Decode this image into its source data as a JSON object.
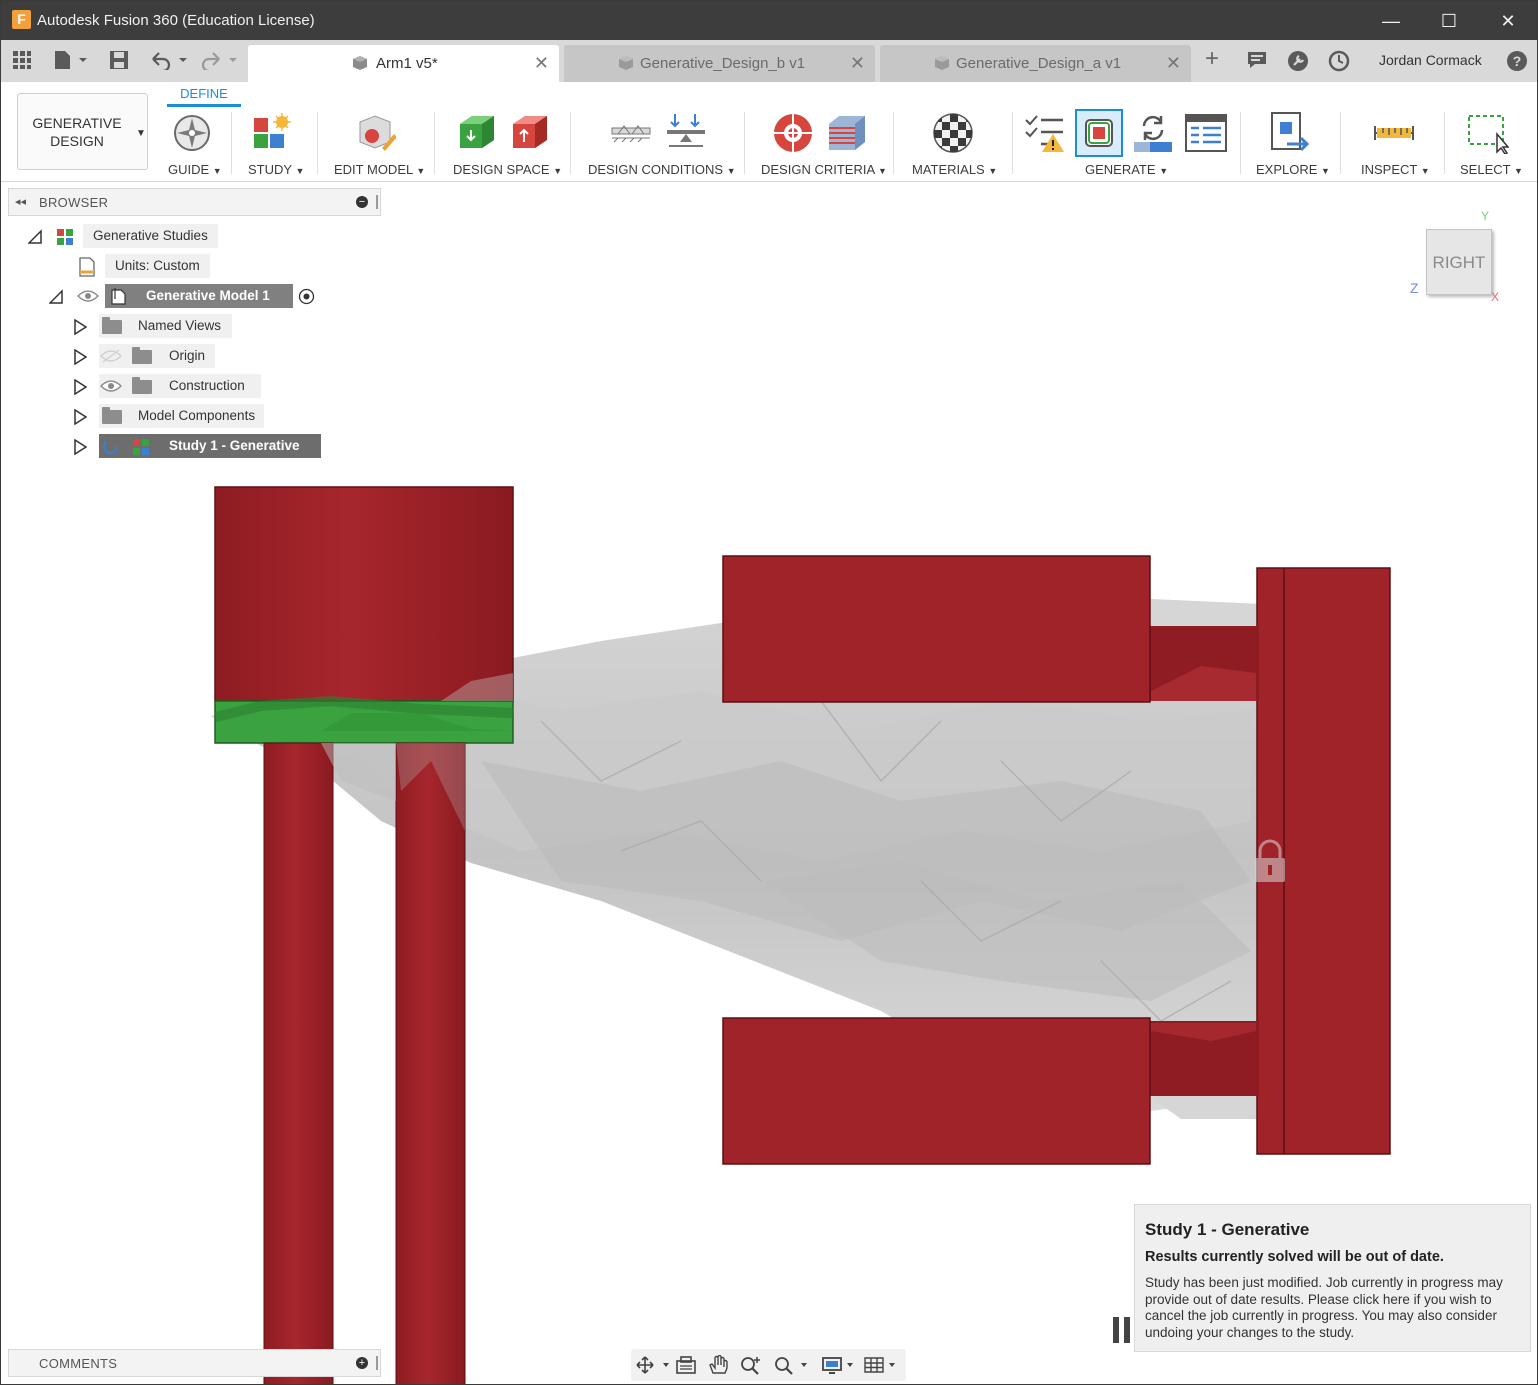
{
  "window": {
    "title": "Autodesk Fusion 360 (Education License)",
    "app_icon_letter": "F",
    "controls": {
      "minimize": "—",
      "maximize": "☐",
      "close": "✕"
    }
  },
  "quickbar": {
    "grid_icon": "grid-icon",
    "file_icon": "file-icon",
    "save_icon": "save-icon",
    "undo_icon": "undo-icon",
    "redo_icon": "redo-icon"
  },
  "tabs": [
    {
      "label": "Arm1 v5*",
      "active": true,
      "close": "✕"
    },
    {
      "label": "Generative_Design_b v1",
      "active": false,
      "close": "✕"
    },
    {
      "label": "Generative_Design_a v1",
      "active": false,
      "close": "✕"
    }
  ],
  "tabbar_right": {
    "new_tab": "+",
    "user_name": "Jordan Cormack",
    "help": "?"
  },
  "toolbar": {
    "workspace": {
      "line1": "GENERATIVE",
      "line2": "DESIGN",
      "caret": "▼"
    },
    "active_tab": "DEFINE",
    "groups": [
      {
        "label": "GUIDE",
        "caret": "▼"
      },
      {
        "label": "STUDY",
        "caret": "▼"
      },
      {
        "label": "EDIT MODEL",
        "caret": "▼"
      },
      {
        "label": "DESIGN SPACE",
        "caret": "▼"
      },
      {
        "label": "DESIGN CONDITIONS",
        "caret": "▼"
      },
      {
        "label": "DESIGN CRITERIA",
        "caret": "▼"
      },
      {
        "label": "MATERIALS",
        "caret": "▼"
      },
      {
        "label": "GENERATE",
        "caret": "▼"
      },
      {
        "label": "EXPLORE",
        "caret": "▼"
      },
      {
        "label": "INSPECT",
        "caret": "▼"
      },
      {
        "label": "SELECT",
        "caret": "▼"
      }
    ]
  },
  "browser": {
    "title": "BROWSER",
    "collapse": "◂◂",
    "minus": "−",
    "items": [
      {
        "label": "Generative Studies"
      },
      {
        "label": "Units: Custom"
      },
      {
        "label": "Generative Model 1"
      },
      {
        "label": "Named Views"
      },
      {
        "label": "Origin"
      },
      {
        "label": "Construction"
      },
      {
        "label": "Model Components"
      },
      {
        "label": "Study 1 - Generative"
      }
    ]
  },
  "viewcube": {
    "face": "RIGHT",
    "y": "Y",
    "z": "Z",
    "x": "X"
  },
  "comments": {
    "title": "COMMENTS",
    "plus": "+"
  },
  "notification": {
    "title": "Study 1 - Generative",
    "subtitle": "Results currently solved will be out of date.",
    "body": "Study has been just modified. Job currently in progress may provide out of date results. Please click here if you wish to cancel the job currently in progress. You may also consider undoing your changes to the study."
  },
  "colors": {
    "obstacle_red": "#a1232a",
    "preserve_green": "#3aa23f",
    "accent_blue": "#1a8fd6",
    "mesh_grey": "#c8c8c8"
  }
}
